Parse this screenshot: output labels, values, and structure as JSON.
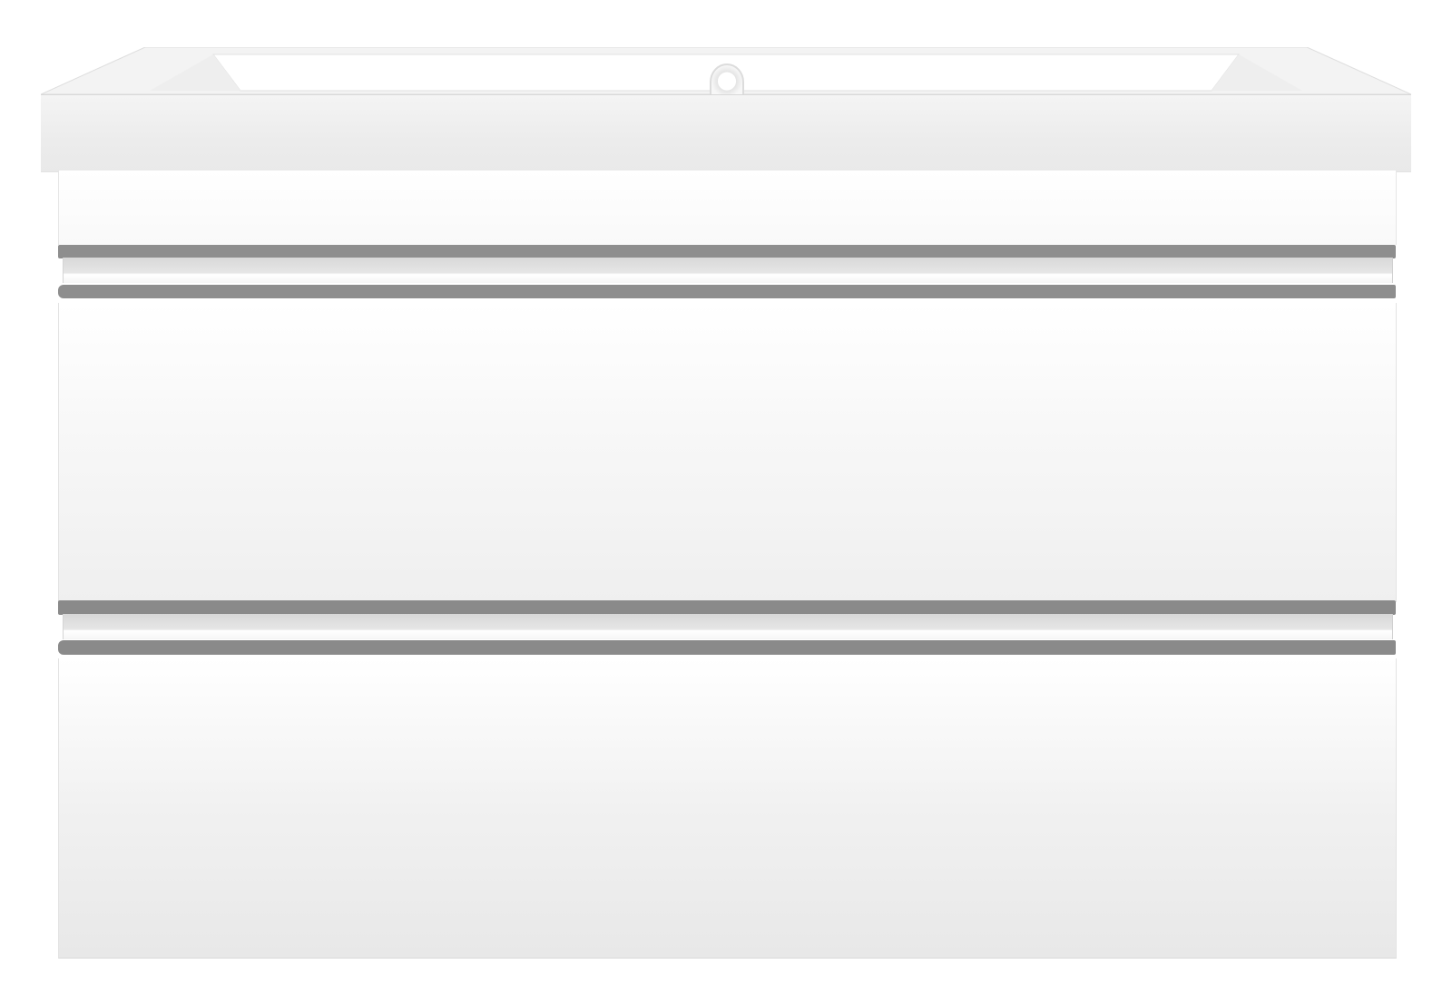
{
  "scene": {
    "subject": "",
    "colors": {
      "background": "#ffffff",
      "cabinet_body": "#f4f4f4",
      "handle_rail": "#8e8e8e",
      "basin": "#f2f2f2"
    },
    "parts": {
      "drawers": 2,
      "handle_rails": 4
    }
  }
}
